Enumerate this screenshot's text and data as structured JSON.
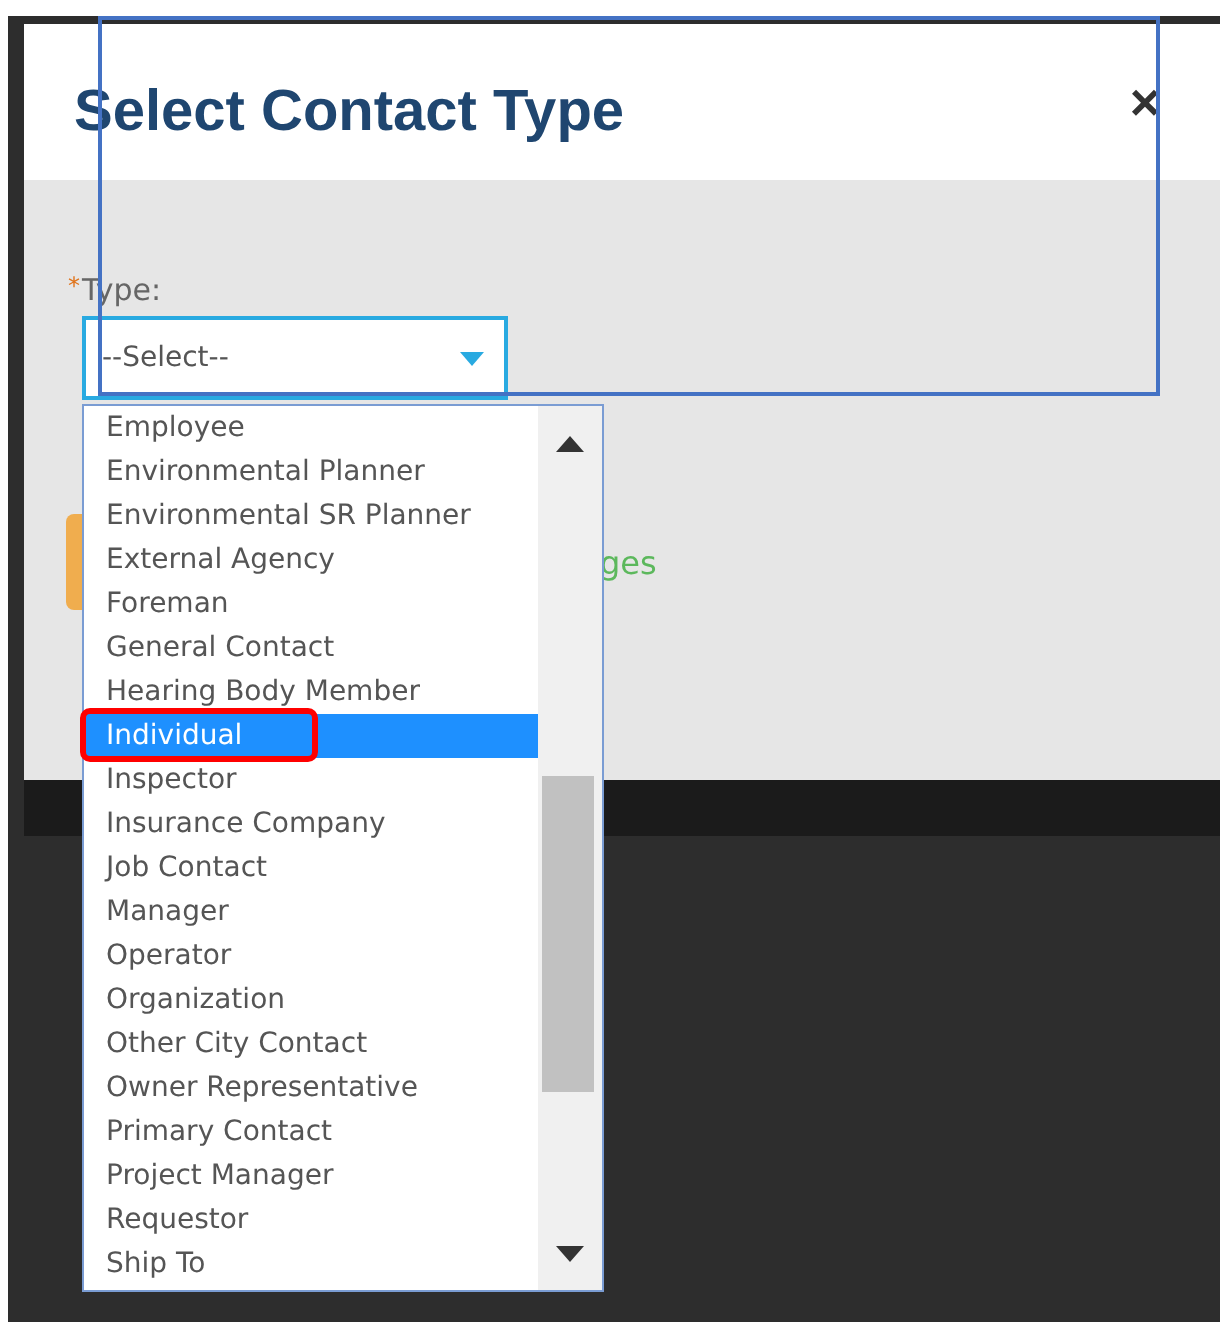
{
  "dialog": {
    "title": "Select Contact Type",
    "close": "×"
  },
  "field": {
    "required_mark": "*",
    "label": "Type:",
    "value": "--Select--"
  },
  "dropdown": {
    "options": [
      {
        "label": "Employee",
        "selected": false
      },
      {
        "label": "Environmental Planner",
        "selected": false
      },
      {
        "label": "Environmental SR Planner",
        "selected": false
      },
      {
        "label": "External Agency",
        "selected": false
      },
      {
        "label": "Foreman",
        "selected": false
      },
      {
        "label": "General Contact",
        "selected": false
      },
      {
        "label": "Hearing Body Member",
        "selected": false
      },
      {
        "label": "Individual",
        "selected": true
      },
      {
        "label": "Inspector",
        "selected": false
      },
      {
        "label": "Insurance Company",
        "selected": false
      },
      {
        "label": "Job Contact",
        "selected": false
      },
      {
        "label": "Manager",
        "selected": false
      },
      {
        "label": "Operator",
        "selected": false
      },
      {
        "label": "Organization",
        "selected": false
      },
      {
        "label": "Other City Contact",
        "selected": false
      },
      {
        "label": "Owner Representative",
        "selected": false
      },
      {
        "label": "Primary Contact",
        "selected": false
      },
      {
        "label": "Project Manager",
        "selected": false
      },
      {
        "label": "Requestor",
        "selected": false
      },
      {
        "label": "Ship To",
        "selected": false
      }
    ]
  },
  "link_fragment": "ges"
}
